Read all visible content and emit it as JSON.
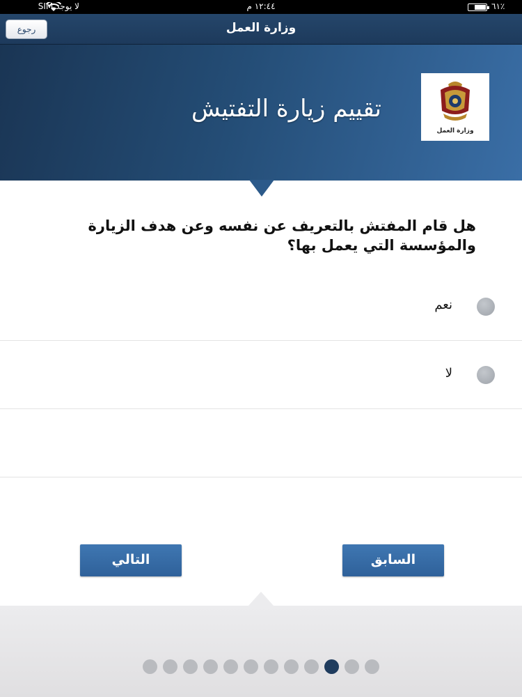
{
  "status_bar": {
    "carrier": "لا يوجد SIM",
    "time": "١٢:٤٤ م",
    "battery": "٪٦١"
  },
  "nav": {
    "title": "وزارة العمل",
    "back_label": "رجوع"
  },
  "banner": {
    "title": "تقييم زيارة التفتيش",
    "logo_caption": "وزارة العمل"
  },
  "question": "هل قام المفتش بالتعريف عن نفسه وعن هدف الزيارة والمؤسسة التي يعمل بها؟",
  "options": [
    {
      "label": "نعم"
    },
    {
      "label": "لا"
    }
  ],
  "buttons": {
    "next_label": "التالي",
    "prev_label": "السابق"
  },
  "pagination": {
    "total_pages": 12,
    "active_index_from_left": 10
  },
  "colors": {
    "nav": "#1d3a5c",
    "button": "#3a6fa8",
    "active_dot": "#1f3c5e"
  }
}
